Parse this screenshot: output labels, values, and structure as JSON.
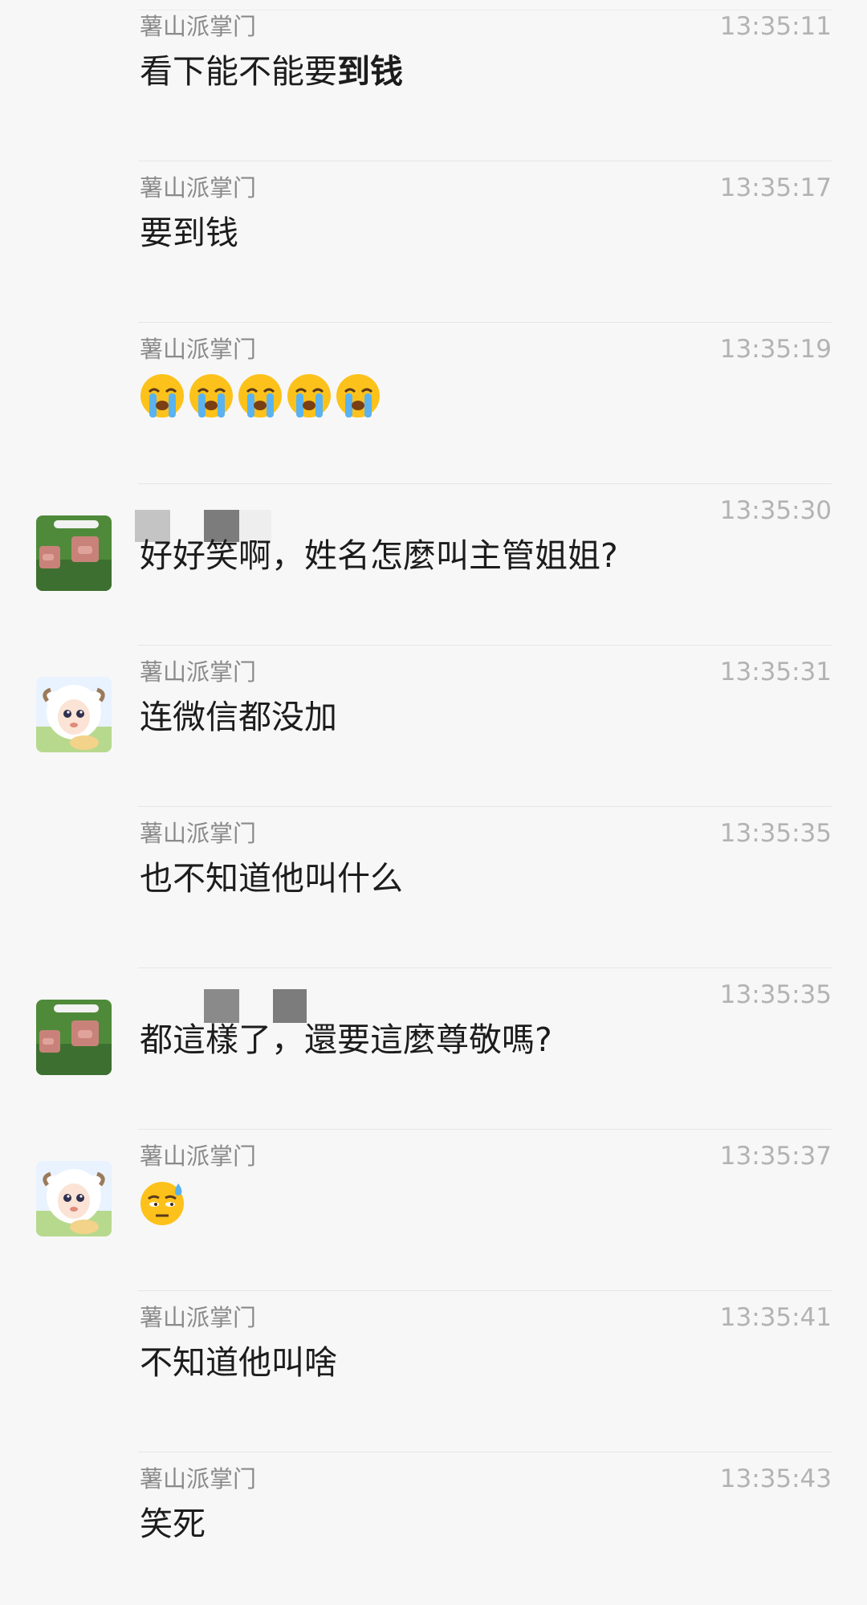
{
  "messages": [
    {
      "sender": "薯山派掌门",
      "time": "13:35:11",
      "text": "看下能不能要",
      "text_bold": "到钱",
      "avatar": "none"
    },
    {
      "sender": "薯山派掌门",
      "time": "13:35:17",
      "text": "要到钱",
      "avatar": "none"
    },
    {
      "sender": "薯山派掌门",
      "time": "13:35:19",
      "emoji": [
        "loudly-crying-face-icon",
        "loudly-crying-face-icon",
        "loudly-crying-face-icon",
        "loudly-crying-face-icon",
        "loudly-crying-face-icon"
      ],
      "avatar": "none"
    },
    {
      "sender": "",
      "time": "13:35:30",
      "text": "好好笑啊，姓名怎麼叫主管姐姐?",
      "avatar": "pig"
    },
    {
      "sender": "薯山派掌门",
      "time": "13:35:31",
      "text": "连微信都没加",
      "avatar": "sheep"
    },
    {
      "sender": "薯山派掌门",
      "time": "13:35:35",
      "text": "也不知道他叫什么",
      "avatar": "none"
    },
    {
      "sender": "",
      "time": "13:35:35",
      "text": "都這樣了，還要這麼尊敬嗎?",
      "avatar": "pig"
    },
    {
      "sender": "薯山派掌门",
      "time": "13:35:37",
      "emoji": [
        "cold-sweat-face-icon"
      ],
      "avatar": "sheep"
    },
    {
      "sender": "薯山派掌门",
      "time": "13:35:41",
      "text": "不知道他叫啥",
      "avatar": "none"
    },
    {
      "sender": "薯山派掌门",
      "time": "13:35:43",
      "text": "笑死",
      "avatar": "none"
    }
  ],
  "colors": {
    "background": "#f7f7f7",
    "sender": "#8a8a8a",
    "time": "#b3b3b3",
    "text": "#1c1c1c",
    "divider": "#e6e6e6"
  }
}
